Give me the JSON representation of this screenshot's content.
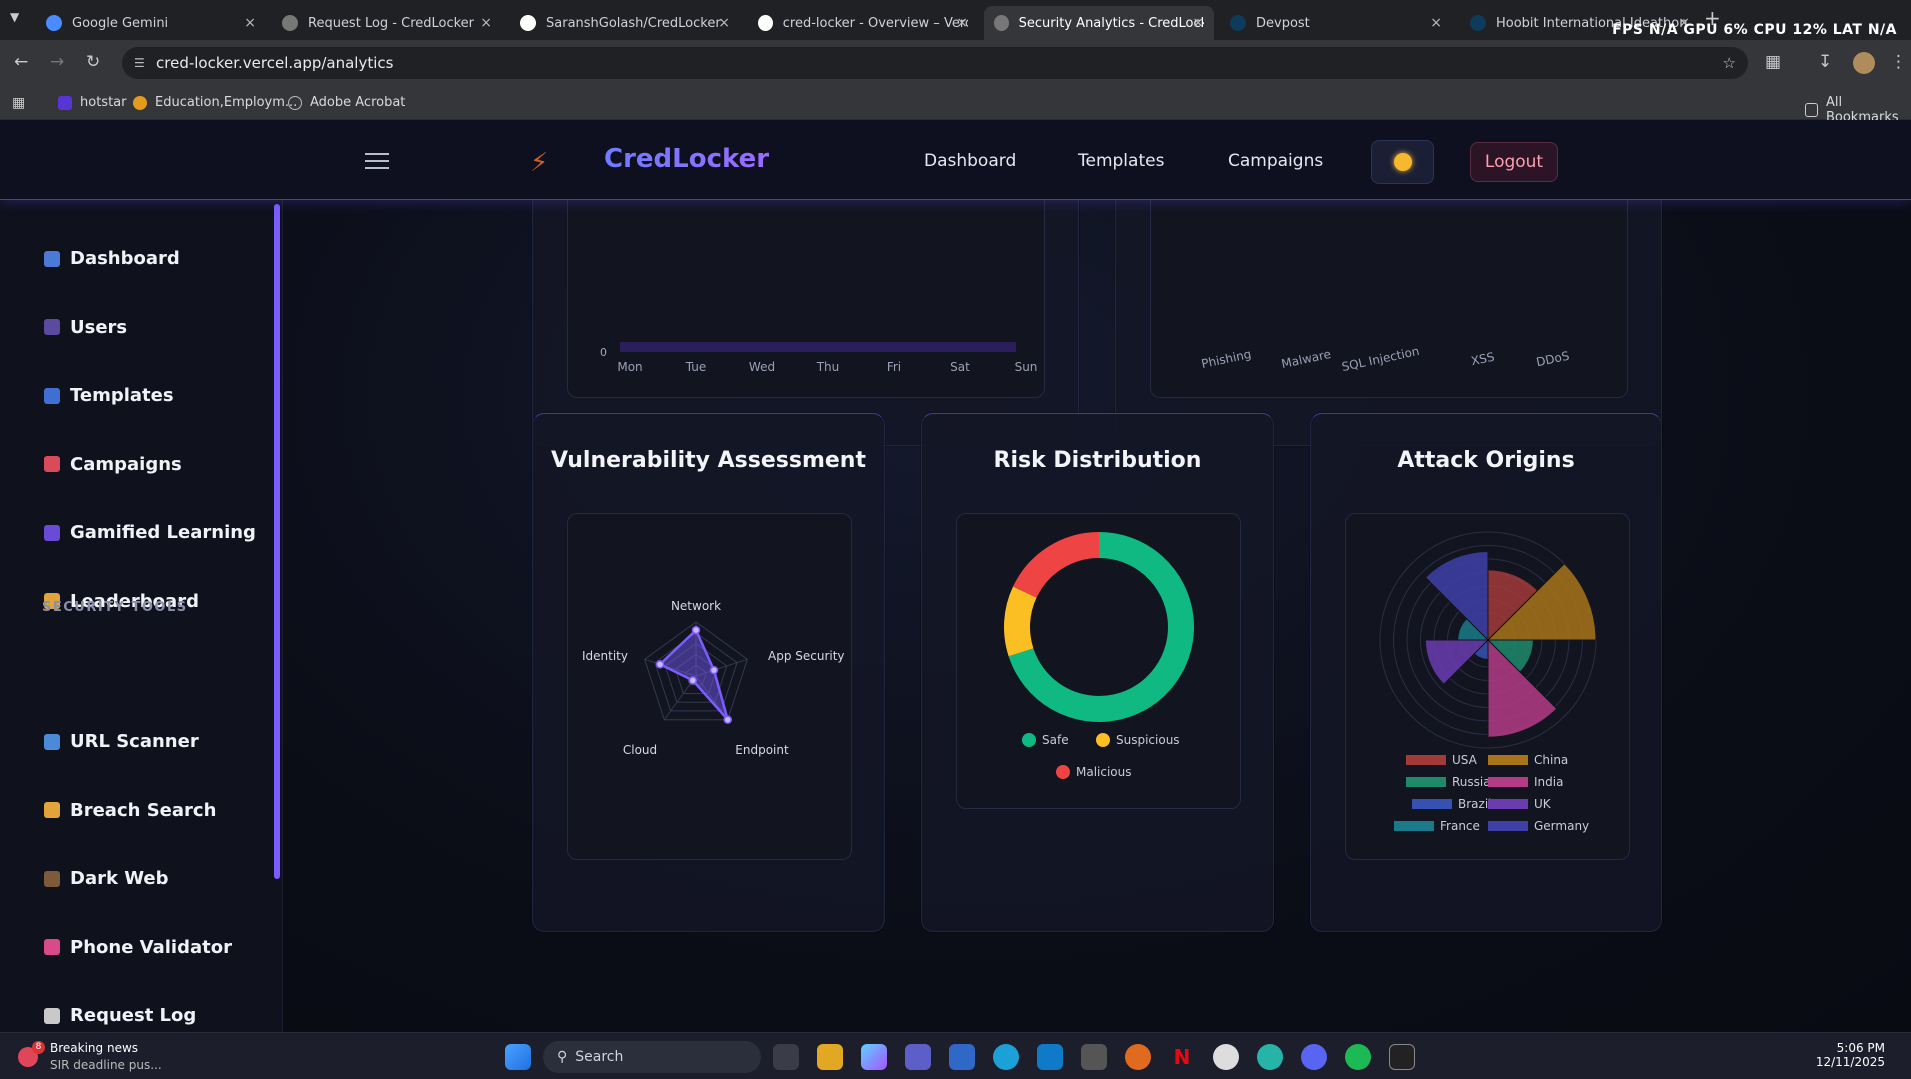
{
  "browser": {
    "tabs": [
      {
        "title": "Google Gemini",
        "icon": "gemini-icon"
      },
      {
        "title": "Request Log - CredLocker",
        "icon": "globe-icon"
      },
      {
        "title": "SaranshGolash/CredLocker",
        "icon": "github-icon"
      },
      {
        "title": "cred-locker - Overview – Vercel",
        "icon": "vercel-icon"
      },
      {
        "title": "Security Analytics - CredLocker",
        "icon": "globe-icon"
      },
      {
        "title": "Devpost",
        "icon": "devpost-icon"
      },
      {
        "title": "Hoobit International Ideathon",
        "icon": "devpost-icon"
      }
    ],
    "perf_overlay": "FPS N/A GPU 6% CPU 12% LAT N/A",
    "url": "cred-locker.vercel.app/analytics",
    "bookmarks": [
      "hotstar",
      "Education,Employm...",
      "Adobe Acrobat"
    ],
    "all_bookmarks": "All Bookmarks"
  },
  "app": {
    "brand": "CredLocker",
    "nav": [
      "Dashboard",
      "Templates",
      "Campaigns"
    ],
    "logout": "Logout",
    "sidebar": {
      "items": [
        {
          "label": "Dashboard",
          "icon": "bar-chart-icon"
        },
        {
          "label": "Users",
          "icon": "users-icon"
        },
        {
          "label": "Templates",
          "icon": "template-icon"
        },
        {
          "label": "Campaigns",
          "icon": "target-icon"
        },
        {
          "label": "Gamified Learning",
          "icon": "gamepad-icon"
        },
        {
          "label": "Leaderboard",
          "icon": "trophy-icon"
        }
      ],
      "section": "SECURITY TOOLS",
      "tools": [
        {
          "label": "URL Scanner",
          "icon": "magnifier-icon"
        },
        {
          "label": "Breach Search",
          "icon": "unlock-icon"
        },
        {
          "label": "Dark Web",
          "icon": "spy-icon"
        },
        {
          "label": "Phone Validator",
          "icon": "phone-icon"
        },
        {
          "label": "Request Log",
          "icon": "document-icon"
        }
      ]
    },
    "top_charts": {
      "left_x_labels": [
        "Mon",
        "Tue",
        "Wed",
        "Thu",
        "Fri",
        "Sat",
        "Sun"
      ],
      "left_y_zero": "0",
      "right_x_labels": [
        "Phishing",
        "Malware",
        "SQL Injection",
        "XSS",
        "DDoS"
      ]
    }
  },
  "chart_data": [
    {
      "type": "radar",
      "title": "Vulnerability Assessment",
      "categories": [
        "Network",
        "App Security",
        "Endpoint",
        "Cloud",
        "Identity"
      ],
      "values": [
        0.85,
        0.35,
        1.0,
        0.1,
        0.7
      ],
      "color": "#7b5cff"
    },
    {
      "type": "pie",
      "title": "Risk Distribution",
      "labels": [
        "Safe",
        "Suspicious",
        "Malicious"
      ],
      "values": [
        70,
        12,
        18
      ],
      "colors": [
        "#10b981",
        "#fbbf24",
        "#ef4444"
      ]
    },
    {
      "type": "polar-area",
      "title": "Attack Origins",
      "labels": [
        "USA",
        "China",
        "Russia",
        "India",
        "Brazil",
        "UK",
        "France",
        "Germany"
      ],
      "values": [
        6.5,
        10,
        4.2,
        9,
        1.8,
        5.8,
        2.8,
        8.2
      ],
      "colors": [
        "#a23a3a",
        "#a8741a",
        "#1f8a6a",
        "#b43b86",
        "#3552b2",
        "#6a3cb0",
        "#1a7a8a",
        "#3f3fa8"
      ]
    }
  ],
  "taskbar": {
    "news_title": "Breaking news",
    "news_sub": "SIR deadline pus...",
    "news_badge": "8",
    "search": "Search",
    "time": "5:06 PM",
    "date": "12/11/2025"
  }
}
